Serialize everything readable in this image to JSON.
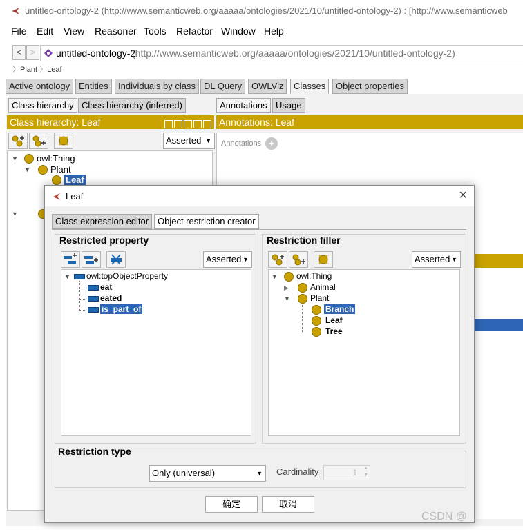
{
  "window": {
    "title": "untitled-ontology-2 (http://www.semanticweb.org/aaaaa/ontologies/2021/10/untitled-ontology-2)  : [http://www.semanticweb"
  },
  "menu": [
    "File",
    "Edit",
    "View",
    "Reasoner",
    "Tools",
    "Refactor",
    "Window",
    "Help"
  ],
  "address": {
    "back": "<",
    "forward": ">",
    "name": "untitled-ontology-2",
    "iri": "(http://www.semanticweb.org/aaaaa/ontologies/2021/10/untitled-ontology-2)"
  },
  "breadcrumb": [
    "Plant",
    "Leaf"
  ],
  "tabs": [
    "Active ontology",
    "Entities",
    "Individuals by class",
    "DL Query",
    "OWLViz",
    "Classes",
    "Object properties"
  ],
  "left_panel": {
    "tabs": [
      "Class hierarchy",
      "Class hierarchy (inferred)"
    ],
    "header": "Class hierarchy: Leaf",
    "mode": "Asserted",
    "tree": {
      "root": "owl:Thing",
      "child": "Plant",
      "selected": "Leaf"
    }
  },
  "right_panel": {
    "tabs": [
      "Annotations",
      "Usage"
    ],
    "header": "Annotations: Leaf",
    "annotations_label": "Annotations"
  },
  "dialog": {
    "title": "Leaf",
    "tabs": [
      "Class expression editor",
      "Object restriction creator"
    ],
    "restricted_property": {
      "label": "Restricted property",
      "mode": "Asserted",
      "root": "owl:topObjectProperty",
      "items": [
        "eat",
        "eated",
        "is_part_of"
      ],
      "selected": "is_part_of"
    },
    "restriction_filler": {
      "label": "Restriction filler",
      "mode": "Asserted",
      "root": "owl:Thing",
      "animal": "Animal",
      "plant": "Plant",
      "plant_children": [
        "Branch",
        "Leaf",
        "Tree"
      ],
      "selected": "Branch"
    },
    "restriction_type": {
      "label": "Restriction type",
      "value": "Only (universal)",
      "cardinality_label": "Cardinality",
      "cardinality_value": "1"
    },
    "buttons": {
      "ok": "确定",
      "cancel": "取消"
    }
  },
  "watermark": "CSDN @"
}
